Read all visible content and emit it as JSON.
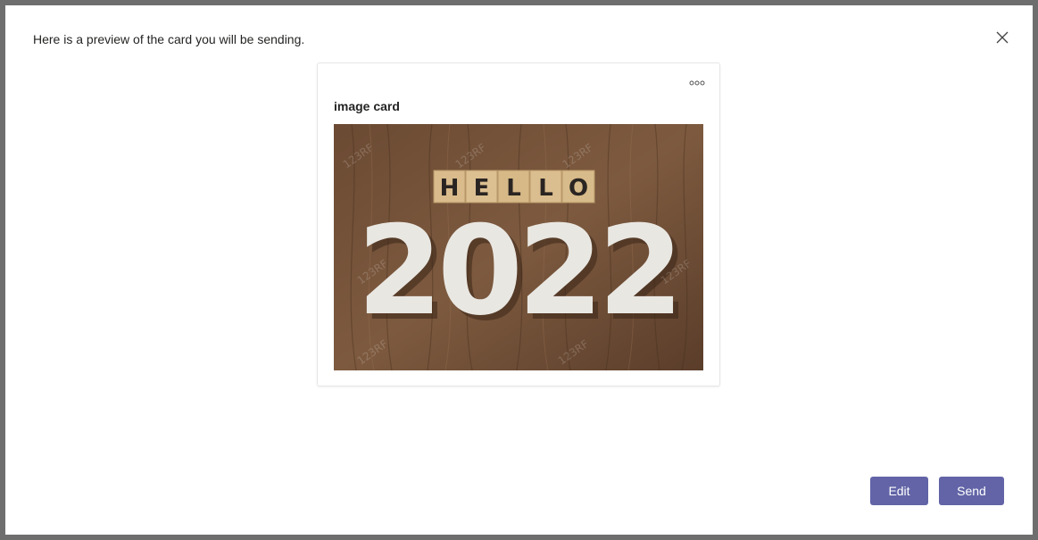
{
  "dialog": {
    "header": "Here is a preview of the card you will be sending.",
    "close_icon": "close-icon"
  },
  "card": {
    "title": "image card",
    "more_icon": "more-options-icon",
    "image": {
      "tiles_text": [
        "H",
        "E",
        "L",
        "L",
        "O"
      ],
      "number_text": "2022",
      "watermark": "123RF"
    }
  },
  "buttons": {
    "edit_label": "Edit",
    "send_label": "Send"
  },
  "colors": {
    "accent": "#6264a7",
    "backdrop": "#6e6e6e"
  }
}
